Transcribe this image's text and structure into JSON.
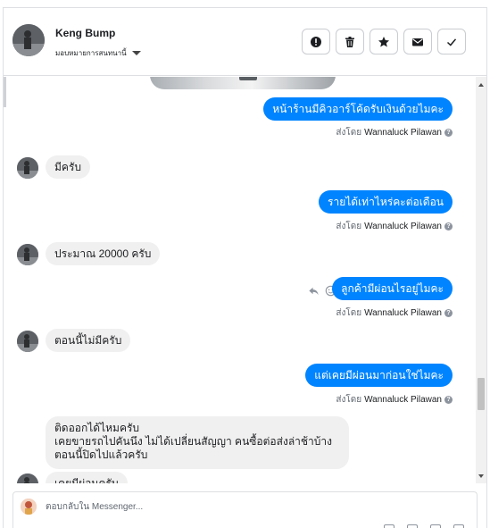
{
  "header": {
    "contact_name": "Keng Bump",
    "assign_label": "มอบหมายการสนทนานี้",
    "actions": [
      {
        "icon": "alert-icon",
        "name": "mark-spam-button"
      },
      {
        "icon": "trash-icon",
        "name": "delete-button"
      },
      {
        "icon": "star-icon",
        "name": "star-button"
      },
      {
        "icon": "envelope-icon",
        "name": "mark-unread-button"
      },
      {
        "icon": "check-icon",
        "name": "mark-done-button"
      }
    ]
  },
  "messages": [
    {
      "dir": "out",
      "text": "หน้าร้านมีคิวอาร์โค้ดรับเงินด้วยไมคะ",
      "sent_prefix": "ส่งโดย",
      "sender": "Wannaluck Pilawan"
    },
    {
      "dir": "in",
      "text": "มีครับ"
    },
    {
      "dir": "out",
      "text": "รายได้เท่าไหร่คะต่อเดือน",
      "sent_prefix": "ส่งโดย",
      "sender": "Wannaluck Pilawan"
    },
    {
      "dir": "in",
      "text": "ประมาณ 20000 ครับ"
    },
    {
      "dir": "out",
      "text": "ลูกค้ามีผ่อนไรอยู่ไมคะ",
      "sent_prefix": "ส่งโดย",
      "sender": "Wannaluck Pilawan"
    },
    {
      "dir": "in",
      "text": "ตอนนี้ไม่มีครับ"
    },
    {
      "dir": "out",
      "text": "แต่เคยมีผ่อนมาก่อนใช่ไมคะ",
      "sent_prefix": "ส่งโดย",
      "sender": "Wannaluck Pilawan"
    },
    {
      "dir": "in",
      "text": "ติดออกได้ไหมครับ\nเคยขายรถไปคันนึง ไม่ได้เปลี่ยนสัญญา คนซื้อต่อส่งล่าช้าบ้าง ตอนนี้ปิดไปแล้วครับ"
    },
    {
      "dir": "in",
      "text": "เคยมีผ่อนครับ"
    }
  ],
  "composer": {
    "placeholder": "ตอบกลับใน Messenger..."
  },
  "colors": {
    "outgoing_bubble": "#0084ff",
    "incoming_bubble": "#f1f0f0"
  }
}
